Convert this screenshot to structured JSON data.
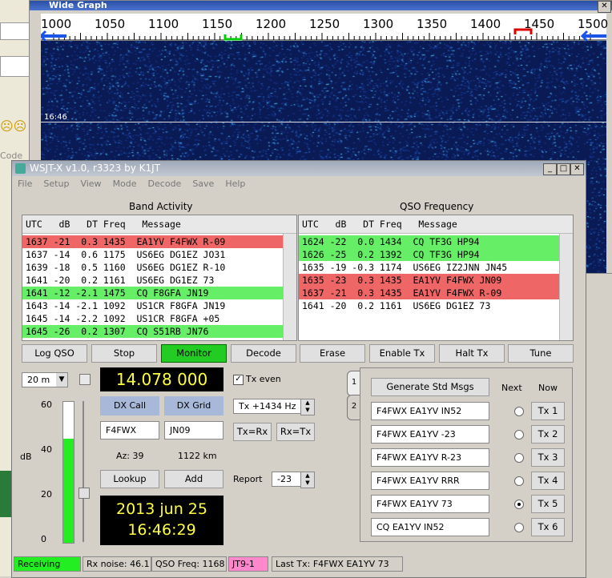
{
  "wide_graph": {
    "title": "Wide Graph",
    "scale": [
      "1000",
      "1050",
      "1100",
      "1150",
      "1200",
      "1250",
      "1300",
      "1350",
      "1400",
      "1450",
      "1500"
    ],
    "timestamp": "16:46"
  },
  "wsjt": {
    "title": "WSJT-X  v1.0, r3323   by K1JT"
  },
  "menu": [
    "File",
    "Setup",
    "View",
    "Mode",
    "Decode",
    "Save",
    "Help"
  ],
  "band": {
    "title": "Band Activity",
    "header": "UTC   dB   DT Freq   Message",
    "rows": [
      {
        "t": "1637 -21  0.3 1435  EA1YV F4FWX R-09",
        "c": "r"
      },
      {
        "t": "1637 -14  0.6 1175  US6EG DG1EZ JO31",
        "c": ""
      },
      {
        "t": "1639 -18  0.5 1160  US6EG DG1EZ R-10",
        "c": ""
      },
      {
        "t": "1641 -20  0.2 1161  US6EG DG1EZ 73",
        "c": ""
      },
      {
        "t": "1641 -12 -2.1 1475  CQ F8GFA JN19",
        "c": "g"
      },
      {
        "t": "1643 -14 -2.1 1092  US1CR F8GFA JN19",
        "c": ""
      },
      {
        "t": "1645 -14 -2.2 1092  US1CR F8GFA +05",
        "c": ""
      },
      {
        "t": "1645 -26  0.2 1307  CQ S51RB JN76",
        "c": "g"
      }
    ]
  },
  "qso": {
    "title": "QSO Frequency",
    "header": "UTC   dB   DT Freq   Message",
    "rows": [
      {
        "t": "1624 -22  0.0 1434  CQ TF3G HP94",
        "c": "g"
      },
      {
        "t": "1626 -25  0.2 1392  CQ TF3G HP94",
        "c": "g"
      },
      {
        "t": "1635 -19 -0.3 1174  US6EG IZ2JNN JN45",
        "c": ""
      },
      {
        "t": "1635 -23  0.3 1435  EA1YV F4FWX JN09",
        "c": "r"
      },
      {
        "t": "1637 -21  0.3 1435  EA1YV F4FWX R-09",
        "c": "r"
      },
      {
        "t": "1641 -20  0.2 1161  US6EG DG1EZ 73",
        "c": ""
      }
    ]
  },
  "buttons": {
    "log_qso": "Log QSO",
    "stop": "Stop",
    "monitor": "Monitor",
    "decode": "Decode",
    "erase": "Erase",
    "enable_tx": "Enable Tx",
    "halt_tx": "Halt Tx",
    "tune": "Tune"
  },
  "band_select": "20 m",
  "frequency": "14.078 000",
  "tx_even": "Tx even",
  "dx": {
    "call_label": "DX Call",
    "grid_label": "DX Grid",
    "call": "F4FWX",
    "grid": "JN09",
    "az": "Az: 39",
    "dist": "1122 km",
    "lookup": "Lookup",
    "add": "Add"
  },
  "tx_freq": "Tx +1434  Hz",
  "tx_eq_rx": "Tx=Rx",
  "rx_eq_tx": "Rx=Tx",
  "report_label": "Report",
  "report": "-23",
  "date": "2013 jun 25",
  "time": "16:46:29",
  "meter": {
    "labels": [
      "60",
      "40",
      "20",
      "0"
    ],
    "unit": "dB",
    "level": 0.74
  },
  "tabs": [
    "1",
    "2"
  ],
  "msgs": {
    "generate": "Generate Std Msgs",
    "next": "Next",
    "now": "Now",
    "items": [
      {
        "text": "F4FWX EA1YV IN52",
        "tx": "Tx 1"
      },
      {
        "text": "F4FWX EA1YV -23",
        "tx": "Tx 2"
      },
      {
        "text": "F4FWX EA1YV R-23",
        "tx": "Tx 3"
      },
      {
        "text": "F4FWX EA1YV RRR",
        "tx": "Tx 4"
      },
      {
        "text": "F4FWX EA1YV 73",
        "tx": "Tx 5"
      },
      {
        "text": "CQ EA1YV IN52",
        "tx": "Tx 6"
      }
    ],
    "selected": 4
  },
  "status": {
    "state": "Receiving",
    "noise": "Rx noise:  46.1",
    "qso_freq": "QSO Freq:  1168",
    "mode": "JT9-1",
    "last_tx": "Last Tx:  F4FWX EA1YV 73"
  },
  "colors": {
    "green": "#66ee66",
    "red": "#ee6666",
    "freq_text": "#ffff40",
    "monitor": "#22cc22",
    "mode": "#ff88cc"
  }
}
